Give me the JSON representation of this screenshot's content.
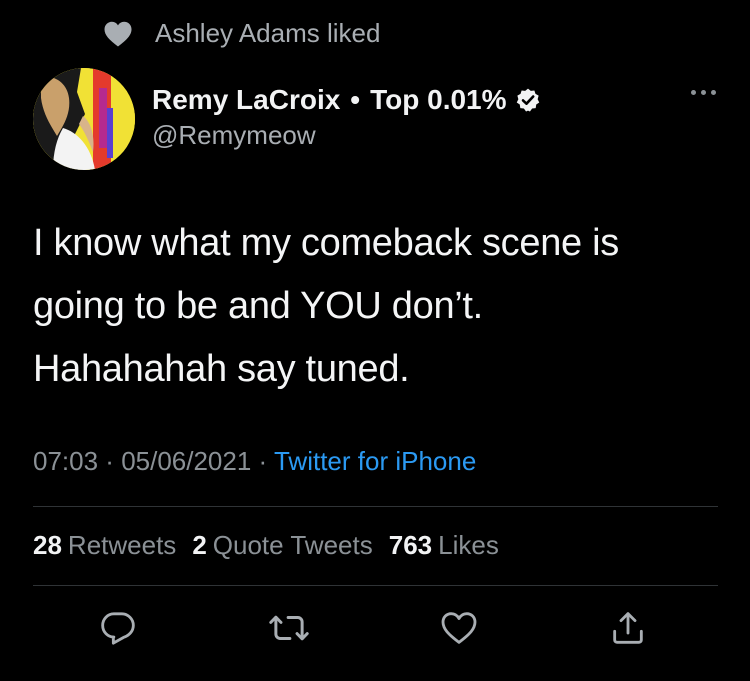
{
  "social_context": {
    "icon": "heart-icon",
    "text": "Ashley Adams liked"
  },
  "author": {
    "display_name": "Remy LaCroix",
    "separator": "•",
    "badge_text": "Top 0.01%",
    "handle": "@Remymeow",
    "verified_icon": "verified-badge-icon"
  },
  "tweet": {
    "lines": [
      "I know what my comeback scene is",
      "going to be and YOU don’t.",
      "Hahahahah say tuned."
    ]
  },
  "meta": {
    "time": "07:03",
    "dot1": " · ",
    "date": "05/06/2021",
    "dot2": " · ",
    "source": "Twitter for iPhone"
  },
  "stats": {
    "retweets_count": "28",
    "retweets_label": "Retweets",
    "quotes_count": "2",
    "quotes_label": "Quote Tweets",
    "likes_count": "763",
    "likes_label": "Likes"
  },
  "actions": [
    {
      "icon": "reply-icon"
    },
    {
      "icon": "retweet-icon"
    },
    {
      "icon": "like-icon"
    },
    {
      "icon": "share-icon"
    }
  ],
  "colors": {
    "background": "#000000",
    "text": "#f4f5f6",
    "secondary": "#8b9196",
    "link": "#2b9af3",
    "divider": "#2f3336"
  }
}
